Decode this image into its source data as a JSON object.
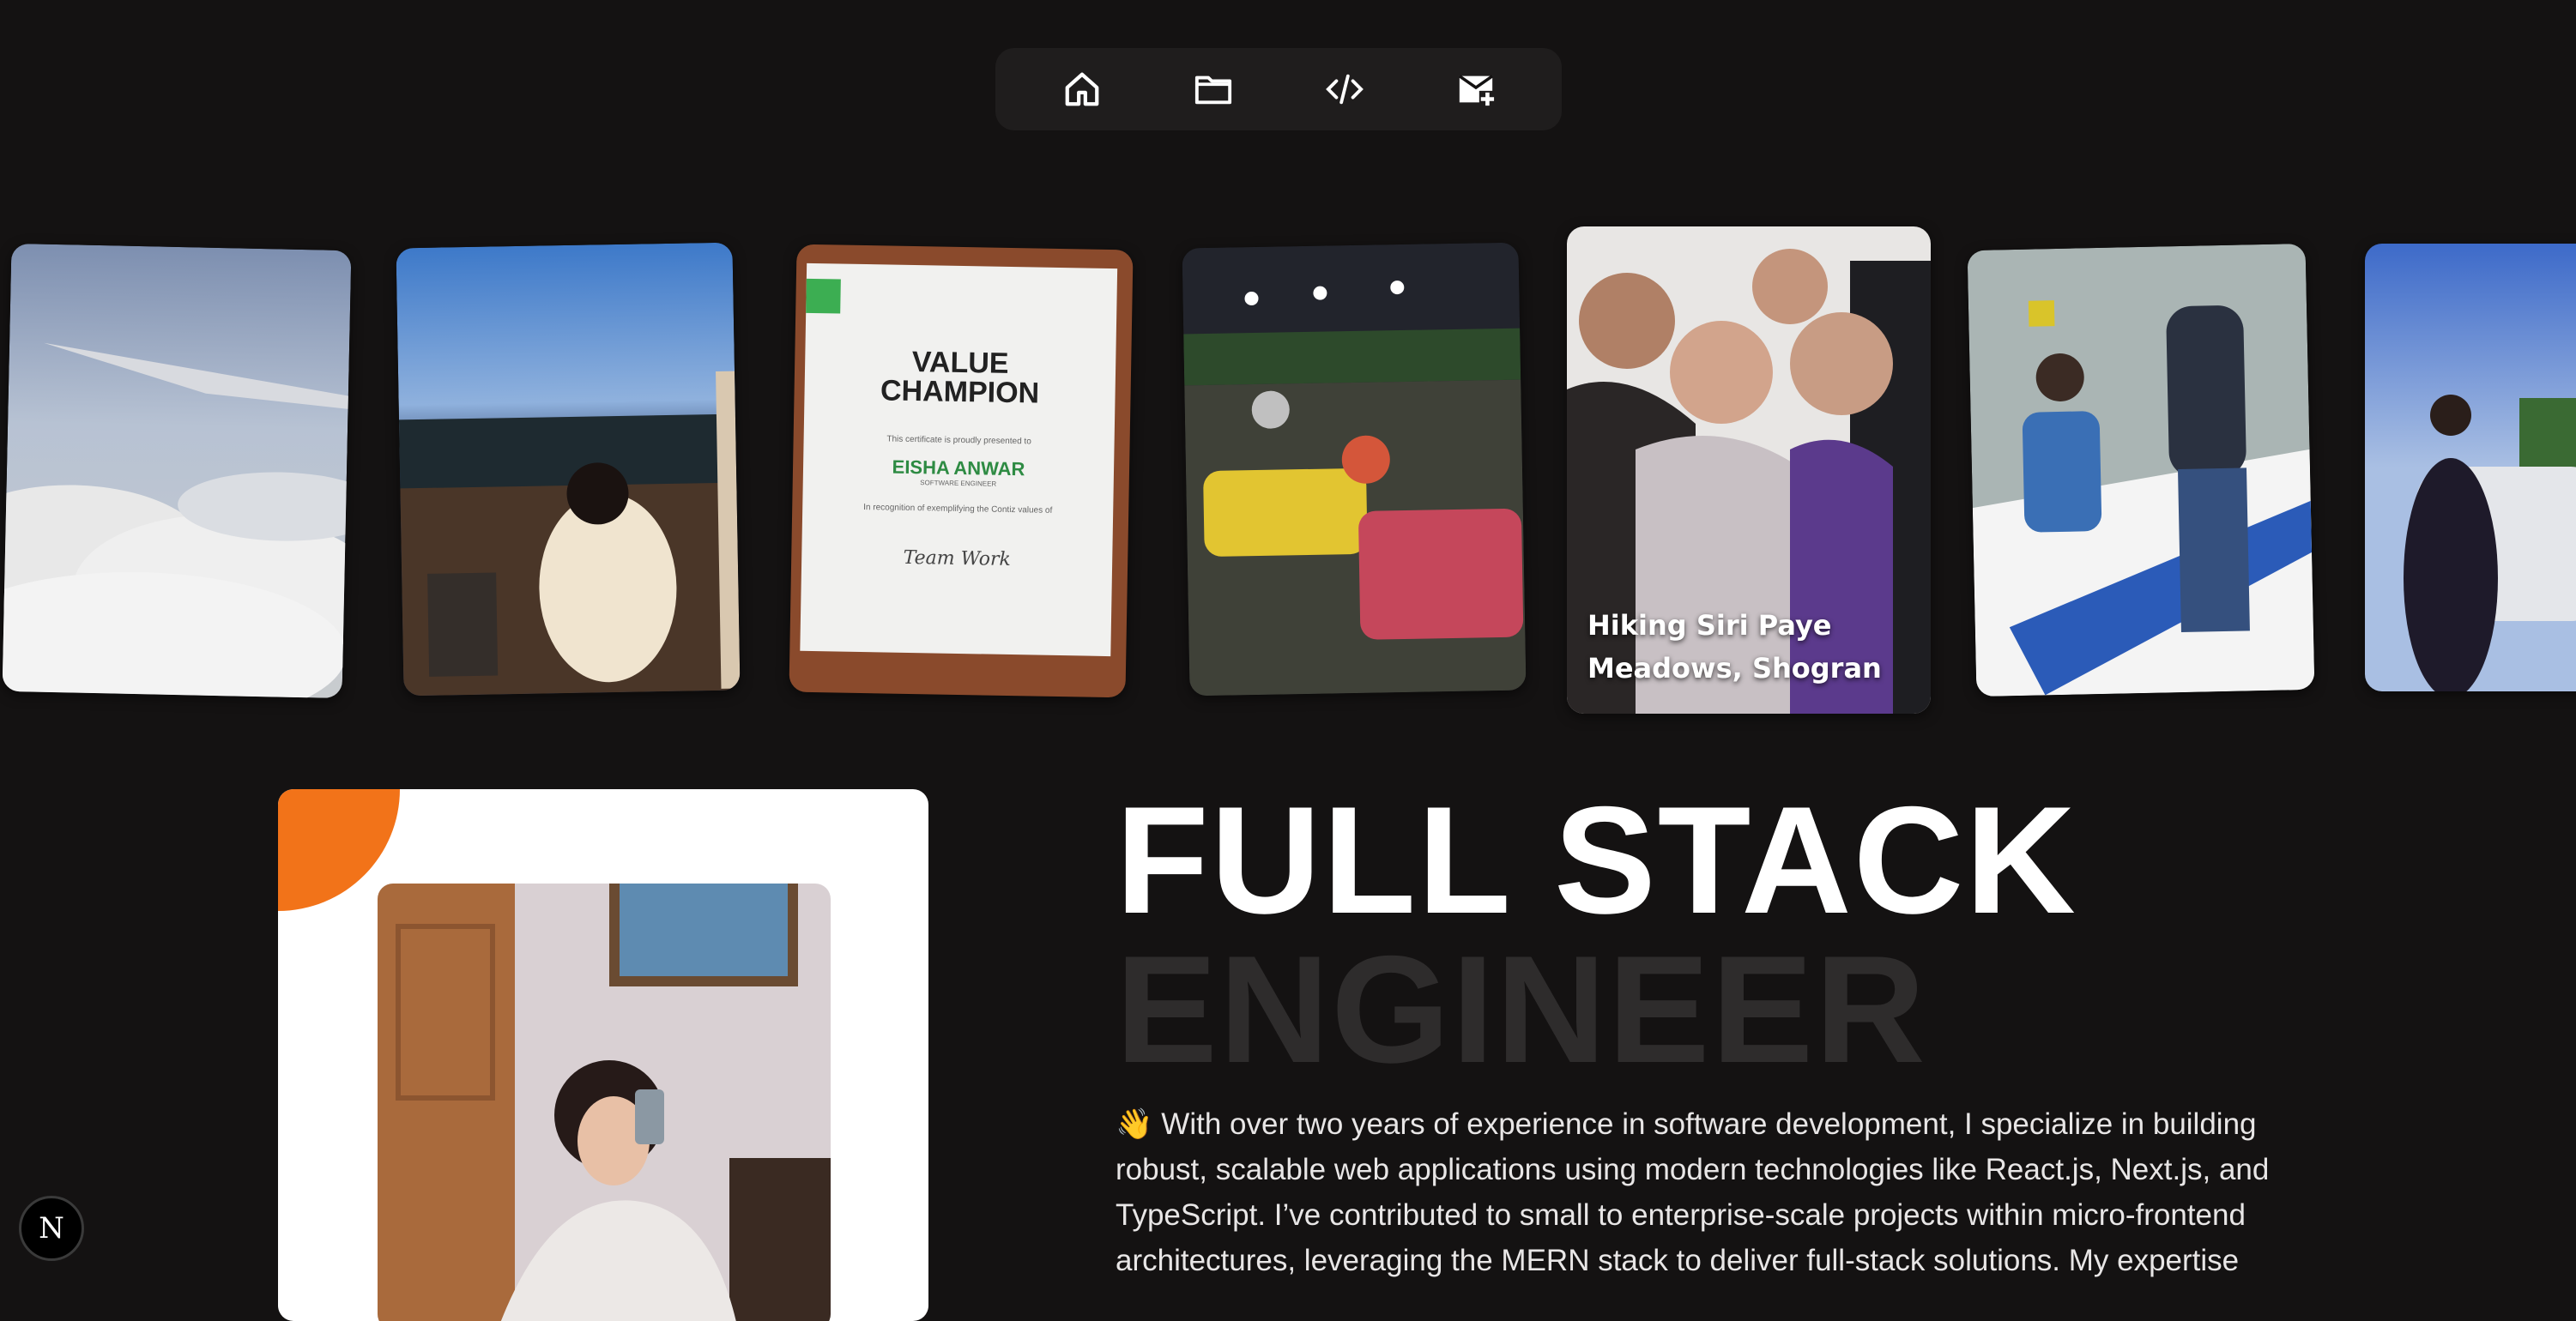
{
  "nav": {
    "items": [
      {
        "icon": "home-icon"
      },
      {
        "icon": "folder-icon"
      },
      {
        "icon": "code-icon"
      },
      {
        "icon": "mail-plus-icon"
      }
    ]
  },
  "gallery": {
    "certificate": {
      "title_line1": "VALUE",
      "title_line2": "CHAMPION",
      "presented": "This certificate is proudly presented to",
      "name": "EISHA ANWAR",
      "role": "SOFTWARE ENGINEER",
      "recognition": "In recognition of exemplifying the Contiz values of",
      "value": "Team Work"
    },
    "featured_caption": "Hiking Siri Paye Meadows, Shogran"
  },
  "hero": {
    "line1": "FULL STACK",
    "line2": "ENGINEER",
    "bio": "👋 With over two years of experience in software development, I specialize in building robust, scalable web applications using modern technologies like React.js, Next.js, and TypeScript. I’ve contributed to small to enterprise-scale projects within micro-frontend architectures, leveraging the MERN stack to deliver full-stack solutions. My expertise"
  },
  "badge": {
    "label": "N"
  },
  "colors": {
    "background": "#141212",
    "accent": "#f27319",
    "nav_bg": "#1f1d1d",
    "muted_heading": "#2e2c2c"
  }
}
